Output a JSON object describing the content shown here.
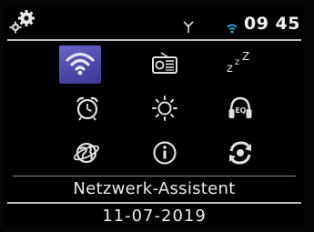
{
  "status": {
    "time": "09 45",
    "settings_icon": "gears-icon",
    "antenna_icon": "antenna-icon",
    "wifi_icon": "wifi-signal-icon",
    "wifi_color": "#2f9bd8"
  },
  "menu": {
    "selected_index": 0,
    "accent": "#5a54b8",
    "items": [
      {
        "icon": "wifi-icon"
      },
      {
        "icon": "radio-icon"
      },
      {
        "icon": "sleep-icon",
        "glyph": "zᶻᶻ"
      },
      {
        "icon": "alarm-clock-icon"
      },
      {
        "icon": "brightness-icon"
      },
      {
        "icon": "equalizer-headphones-icon",
        "glyph": "EQ"
      },
      {
        "icon": "globe-icon"
      },
      {
        "icon": "info-icon",
        "glyph": "i"
      },
      {
        "icon": "refresh-icon"
      }
    ]
  },
  "footer": {
    "item_label": "Netzwerk-Assistent",
    "date": "11-07-2019"
  }
}
